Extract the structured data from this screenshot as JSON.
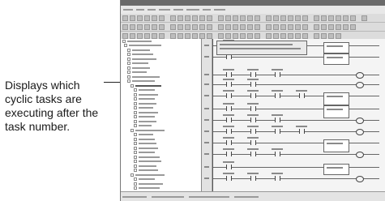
{
  "callout": {
    "lines": [
      "Displays which",
      "cyclic tasks are",
      "executing after the",
      "task number."
    ]
  }
}
